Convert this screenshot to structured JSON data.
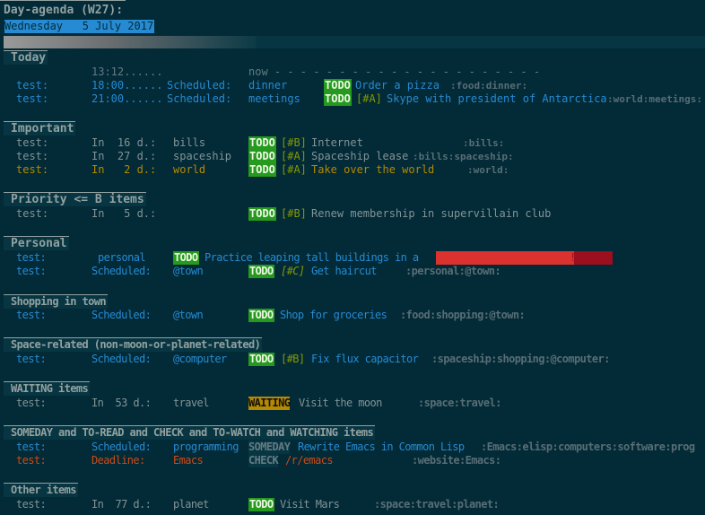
{
  "title": "Day-agenda (W27):",
  "date": "Wednesday   5 July 2017",
  "colors": {
    "background": "#022a37",
    "todo": "#259a1f",
    "waiting": "#b58900",
    "scheduled": "#268bd2",
    "deadline": "#cb4b16"
  },
  "today": {
    "header": "Today",
    "now": {
      "time": "13:12......",
      "marker": "now - - - - - - - - - - - - - - - - - - - - -"
    },
    "rows": [
      {
        "cat": "test:",
        "time": "18:00......",
        "type": "Scheduled:",
        "ctx": "dinner",
        "kw": "TODO",
        "prio": "",
        "title": "Order a pizza",
        "tags": ":food:dinner:"
      },
      {
        "cat": "test:",
        "time": "21:00......",
        "type": "Scheduled:",
        "ctx": "meetings",
        "kw": "TODO",
        "prio": "[#A]",
        "title": "Skype with president of Antarctica",
        "tags": ":world:meetings:"
      }
    ]
  },
  "important": {
    "header": "Important",
    "rows": [
      {
        "cat": "test:",
        "when": "In  16 d.:",
        "ctx": "bills",
        "kw": "TODO",
        "prio": "[#B]",
        "title": "Internet",
        "tags": ":bills:"
      },
      {
        "cat": "test:",
        "when": "In  27 d.:",
        "ctx": "spaceship",
        "kw": "TODO",
        "prio": "[#A]",
        "title": "Spaceship lease",
        "tags": ":bills:spaceship:"
      },
      {
        "cat": "test:",
        "when": "In   2 d.:",
        "ctx": "world",
        "kw": "TODO",
        "prio": "[#A]",
        "title": "Take over the world",
        "tags": ":world:"
      }
    ]
  },
  "priority": {
    "header": "Priority <= B items",
    "rows": [
      {
        "cat": "test:",
        "when": "In   5 d.:",
        "kw": "TODO",
        "prio": "[#B]",
        "title": "Renew membership in supervillain club"
      }
    ]
  },
  "personal": {
    "header": "Personal",
    "rows": [
      {
        "cat": "test:",
        "ctx": "personal",
        "kw": "TODO",
        "title": "Practice leaping tall buildings in a",
        "mark": "!"
      },
      {
        "cat": "test:",
        "type": "Scheduled:",
        "ctx": "@town",
        "kw": "TODO",
        "prio": "[#C]",
        "title": "Get haircut",
        "tags": ":personal:@town:"
      }
    ]
  },
  "shopping": {
    "header": "Shopping in town",
    "rows": [
      {
        "cat": "test:",
        "type": "Scheduled:",
        "ctx": "@town",
        "kw": "TODO",
        "title": "Shop for groceries",
        "tags": ":food:shopping:@town:"
      }
    ]
  },
  "space": {
    "header": "Space-related (non-moon-or-planet-related)",
    "rows": [
      {
        "cat": "test:",
        "type": "Scheduled:",
        "ctx": "@computer",
        "kw": "TODO",
        "prio": "[#B]",
        "title": "Fix flux capacitor",
        "tags": ":spaceship:shopping:@computer:"
      }
    ]
  },
  "waiting": {
    "header": "WAITING items",
    "rows": [
      {
        "cat": "test:",
        "when": "In  53 d.:",
        "ctx": "travel",
        "kw": "WAITING",
        "title": "Visit the moon",
        "tags": ":space:travel:"
      }
    ]
  },
  "someday": {
    "header": "SOMEDAY and TO-READ and CHECK and TO-WATCH and WATCHING items",
    "rows": [
      {
        "cat": "test:",
        "type": "Scheduled:",
        "ctx": "programming",
        "kw": "SOMEDAY",
        "title": "Rewrite Emacs in Common Lisp",
        "tags": ":Emacs:elisp:computers:software:prog"
      },
      {
        "cat": "test:",
        "type": "Deadline:",
        "ctx": "Emacs",
        "kw": "CHECK",
        "title": "/r/emacs",
        "tags": ":website:Emacs:"
      }
    ]
  },
  "other": {
    "header": "Other items",
    "rows": [
      {
        "cat": "test:",
        "when": "In  77 d.:",
        "ctx": "planet",
        "kw": "TODO",
        "title": "Visit Mars",
        "tags": ":space:travel:planet:"
      }
    ]
  }
}
